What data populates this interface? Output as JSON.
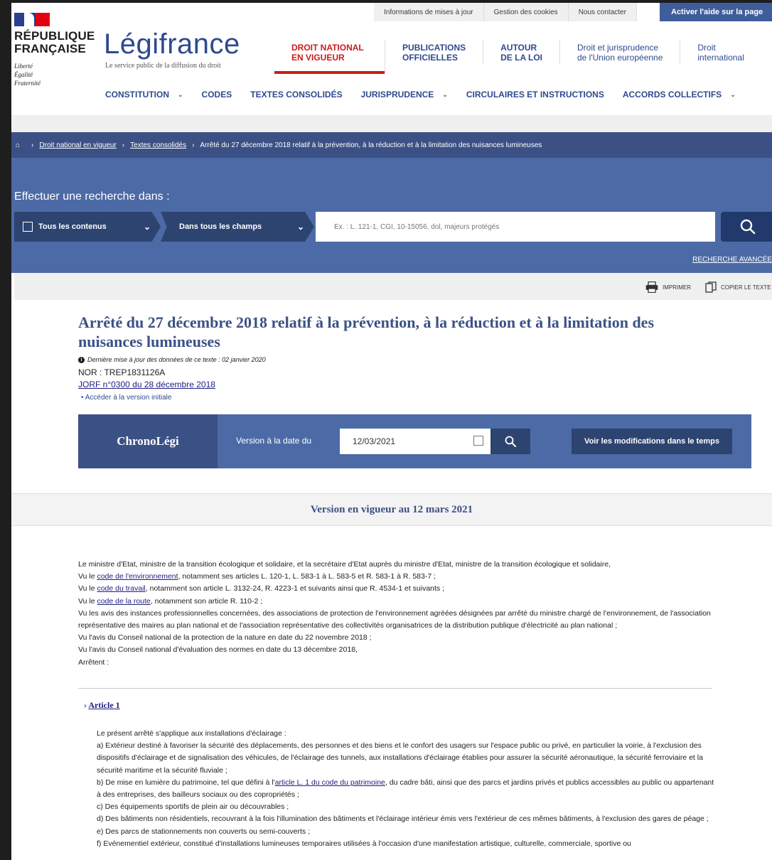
{
  "utility": {
    "links": [
      "Informations de mises à jour",
      "Gestion des cookies",
      "Nous contacter"
    ],
    "help_button": "Activer l'aide sur la page"
  },
  "brand": {
    "republic": "RÉPUBLIQUE FRANÇAISE",
    "motto": "Liberté Égalité Fraternité",
    "logo": "Légifrance",
    "tagline": "Le service public de la diffusion du droit"
  },
  "main_nav": [
    {
      "label": "DROIT NATIONAL EN VIGUEUR",
      "active": true
    },
    {
      "label": "PUBLICATIONS OFFICIELLES"
    },
    {
      "label": "AUTOUR DE LA LOI"
    },
    {
      "label": "Droit et jurisprudence de l'Union européenne"
    },
    {
      "label": "Droit international"
    }
  ],
  "sub_nav": [
    "CONSTITUTION",
    "CODES",
    "TEXTES CONSOLIDÉS",
    "JURISPRUDENCE",
    "CIRCULAIRES ET INSTRUCTIONS",
    "ACCORDS COLLECTIFS"
  ],
  "breadcrumb": {
    "items": [
      "Droit national en vigueur",
      "Textes consolidés"
    ],
    "current": "Arrêté du 27 décembre 2018 relatif à la prévention, à la réduction et à la limitation des nuisances lumineuses"
  },
  "search": {
    "title": "Effectuer une recherche dans :",
    "scope": "Tous les contenus",
    "field": "Dans tous les champs",
    "placeholder": "Ex. : L. 121-1, CGI, 10-15056, dol, majeurs protégés",
    "advanced": "RECHERCHE AVANCÉE"
  },
  "toolbar": {
    "print": "IMPRIMER",
    "copy": "COPIER LE TEXTE"
  },
  "document": {
    "title": "Arrêté du 27 décembre 2018 relatif à la prévention, à la réduction et à la limitation des nuisances lumineuses",
    "last_update": "Dernière mise à jour des données de ce texte : 02 janvier 2020",
    "nor": "NOR : TREP1831126A",
    "jorf": "JORF n°0300 du 28 décembre 2018",
    "initial_version": "Accéder à la version initiale"
  },
  "chronolegi": {
    "label": "ChronoLégi",
    "version_text": "Version à la date du",
    "date": "12/03/2021",
    "modifications_button": "Voir les modifications dans le temps"
  },
  "version_band": "Version en vigueur au 12 mars 2021",
  "preamble": [
    {
      "text": "Le ministre d'Etat, ministre de la transition écologique et solidaire, et la secrétaire d'Etat auprès du ministre d'Etat, ministre de la transition écologique et solidaire,"
    },
    {
      "pre": "Vu le ",
      "link": "code de l'environnement",
      "post": ", notamment ses articles L. 120-1, L. 583-1 à L. 583-5 et R. 583-1 à R. 583-7 ;"
    },
    {
      "pre": "Vu le ",
      "link": "code du travail",
      "post": ", notamment son article L. 3132-24, R. 4223-1 et suivants ainsi que R. 4534-1 et suivants ;"
    },
    {
      "pre": "Vu le ",
      "link": "code de la route",
      "post": ", notamment son article R. 110-2 ;"
    },
    {
      "text": "Vu les avis des instances professionnelles concernées, des associations de protection de l'environnement agréées désignées par arrêté du ministre chargé de l'environnement, de l'association représentative des maires au plan national et de l'association représentative des collectivités organisatrices de la distribution publique d'électricité au plan national ;"
    },
    {
      "text": "Vu l'avis du Conseil national de la protection de la nature en date du 22 novembre 2018 ;"
    },
    {
      "text": "Vu l'avis du Conseil national d'évaluation des normes en date du 13 décembre 2018,"
    },
    {
      "text": "Arrêtent :"
    }
  ],
  "article1": {
    "heading": "Article 1",
    "lines": [
      {
        "text": "Le présent arrêté s'applique aux installations d'éclairage :"
      },
      {
        "text": "a) Extérieur destiné à favoriser la sécurité des déplacements, des personnes et des biens et le confort des usagers sur l'espace public ou privé, en particulier la voirie, à l'exclusion des dispositifs d'éclairage et de signalisation des véhicules, de l'éclairage des tunnels, aux installations d'éclairage établies pour assurer la sécurité aéronautique, la sécurité ferroviaire et la sécurité maritime et la sécurité fluviale ;"
      },
      {
        "pre": "b) De mise en lumière du patrimoine, tel que défini à l'",
        "link": "article L. 1 du code du patrimoine",
        "post": ", du cadre bâti, ainsi que des parcs et jardins privés et publics accessibles au public ou appartenant à des entreprises, des bailleurs sociaux ou des copropriétés ;"
      },
      {
        "text": "c) Des équipements sportifs de plein air ou découvrables ;"
      },
      {
        "text": "d) Des bâtiments non résidentiels, recouvrant à la fois l'illumination des bâtiments et l'éclairage intérieur émis vers l'extérieur de ces mêmes bâtiments, à l'exclusion des gares de péage ;"
      },
      {
        "text": "e) Des parcs de stationnements non couverts ou semi-couverts ;"
      },
      {
        "text": "f) Evénementiel extérieur, constitué d'installations lumineuses temporaires utilisées à l'occasion d'une manifestation artistique, culturelle, commerciale, sportive ou"
      }
    ]
  }
}
